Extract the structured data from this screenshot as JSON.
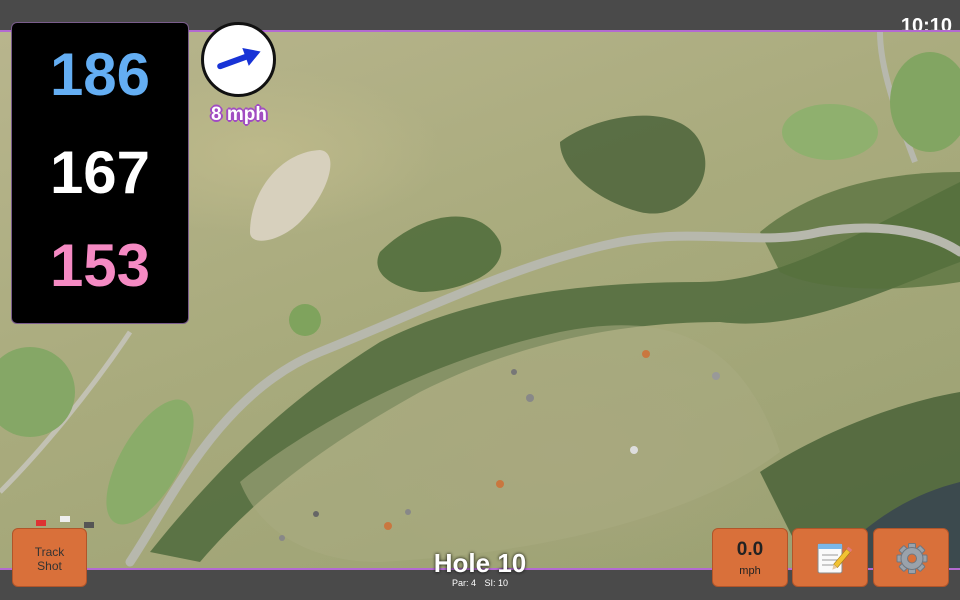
{
  "status_bar": {
    "time": "10:10"
  },
  "distances": {
    "back": "186",
    "middle": "167",
    "front": "153"
  },
  "wind": {
    "speed_label": "8 mph",
    "direction_icon": "arrow-right-icon"
  },
  "buttons": {
    "track_shot_line1": "Track",
    "track_shot_line2": "Shot",
    "speed_value": "0.0",
    "speed_unit": "mph",
    "notes_icon": "notepad-icon",
    "settings_icon": "gear-icon"
  },
  "hole": {
    "title": "Hole 10",
    "par": "Par: 4",
    "si": "SI: 10"
  },
  "colors": {
    "back_distance": "#64aef3",
    "middle_distance": "#ffffff",
    "front_distance": "#f58ac3",
    "button_orange": "#d9703a",
    "accent_purple": "#a14cc2"
  }
}
